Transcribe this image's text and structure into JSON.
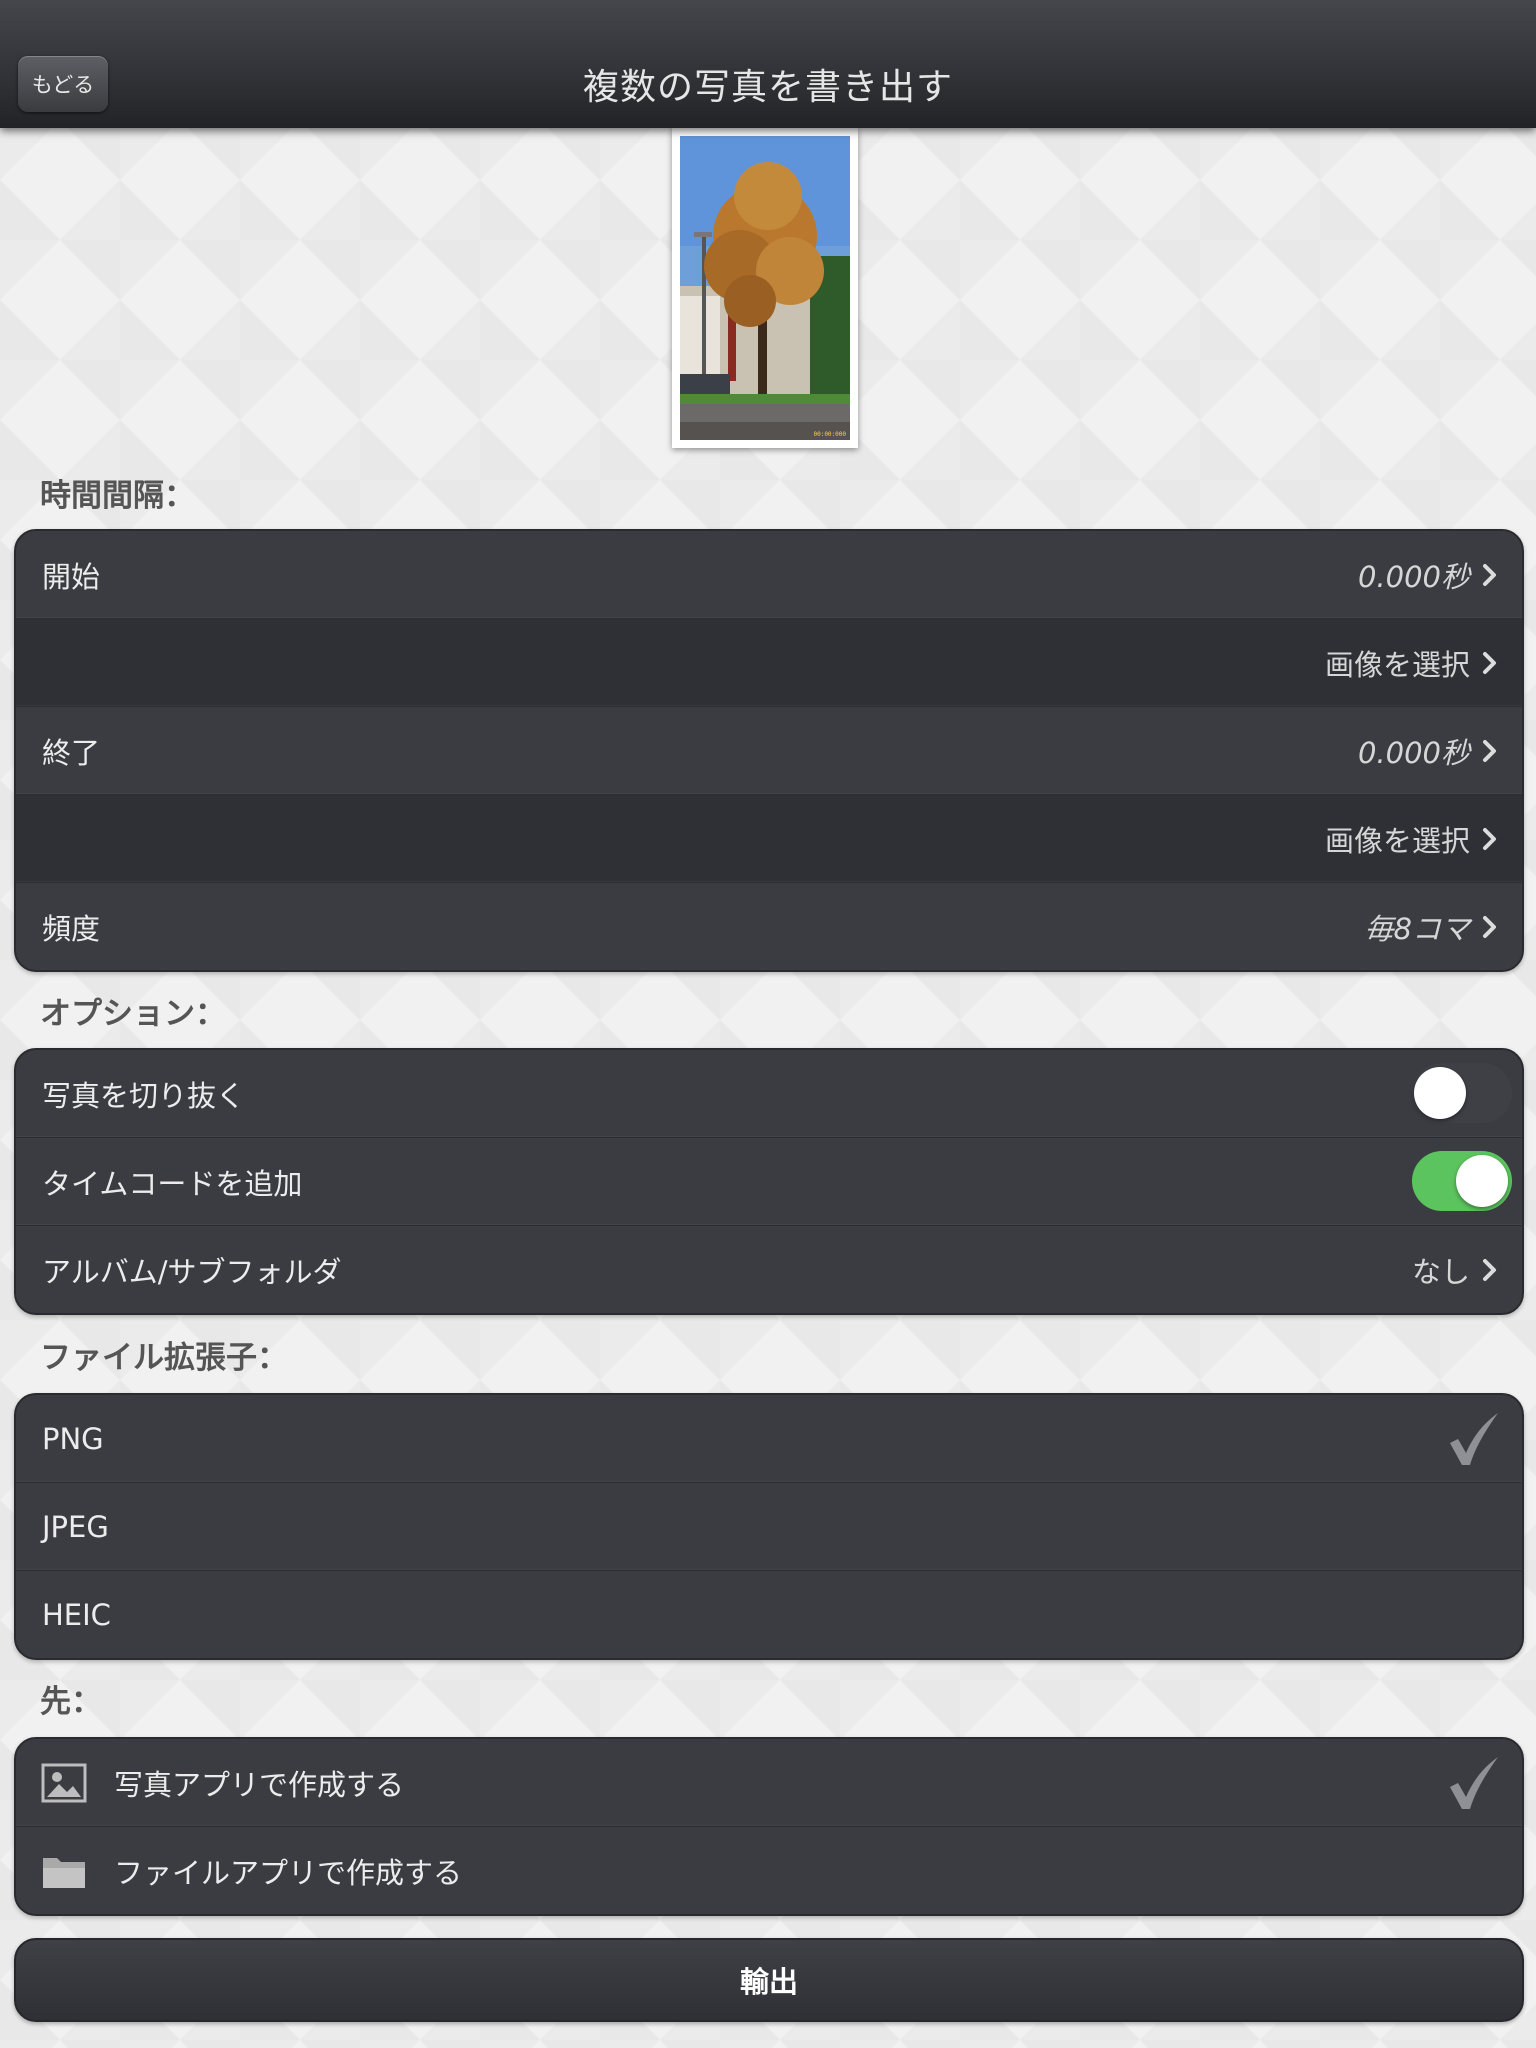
{
  "nav": {
    "back_label": "もどる",
    "title": "複数の写真を書き出す"
  },
  "sections": {
    "interval": "時間間隔：",
    "options": "オプション：",
    "extension": "ファイル拡張子：",
    "destination": "先："
  },
  "interval_rows": {
    "start_label": "開始",
    "start_value": "0.000秒",
    "select_image_1": "画像を選択",
    "end_label": "終了",
    "end_value": "0.000秒",
    "select_image_2": "画像を選択",
    "frequency_label": "頻度",
    "frequency_value": "毎8コマ"
  },
  "option_rows": {
    "crop_label": "写真を切り抜く",
    "crop_enabled": false,
    "timecode_label": "タイムコードを追加",
    "timecode_enabled": true,
    "album_label": "アルバム/サブフォルダ",
    "album_value": "なし"
  },
  "extension_rows": {
    "png": "PNG",
    "jpeg": "JPEG",
    "heic": "HEIC",
    "selected": "PNG"
  },
  "destination_rows": {
    "photos_app": "写真アプリで作成する",
    "files_app": "ファイルアプリで作成する",
    "selected": "photos_app"
  },
  "thumbnail": {
    "timecode": "00:00:000"
  },
  "export_label": "輸出",
  "colors": {
    "toggle_on": "#5cc45e",
    "row_bg": "#3b3c42",
    "nav_bg": "#2c2d31"
  }
}
